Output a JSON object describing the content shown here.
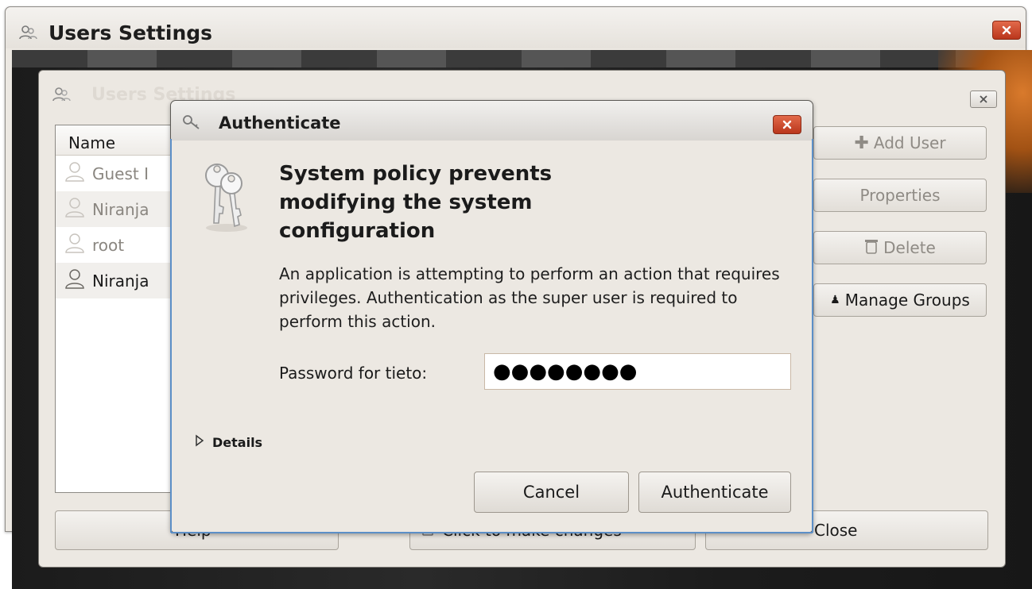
{
  "outer_window": {
    "title": "Users Settings"
  },
  "inner_window": {
    "title": "Users Settings",
    "list_header": "Name",
    "users": [
      {
        "name": "Guest I"
      },
      {
        "name": "Niranja"
      },
      {
        "name": "root"
      },
      {
        "name": "Niranja"
      }
    ],
    "buttons": {
      "add_user": "Add User",
      "properties": "Properties",
      "delete": "Delete",
      "manage_groups": "Manage Groups",
      "help": "Help",
      "unlock": "Click to make changes",
      "close": "Close"
    }
  },
  "auth_dialog": {
    "title": "Authenticate",
    "heading": "System policy prevents modifying the system configuration",
    "message": "An application is attempting to perform an action that requires privileges. Authentication as the super user is required to perform this action.",
    "password_label": "Password for tieto:",
    "password_value": "●●●●●●●●",
    "details_label": "Details",
    "cancel_label": "Cancel",
    "authenticate_label": "Authenticate"
  }
}
